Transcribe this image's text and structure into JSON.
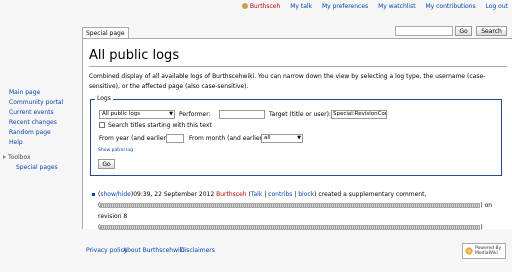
{
  "personal": {
    "username": "Burthscehwiki",
    "items": [
      "Burthsceh",
      "My talk",
      "My preferences",
      "My watchlist",
      "My contributions",
      "Log out"
    ]
  },
  "tab": {
    "label": "Special page"
  },
  "search": {
    "value": "",
    "go_label": "Go",
    "search_label": "Search"
  },
  "page": {
    "title": "All public logs",
    "intro": "Combined display of all available logs of Burthscehwiki. You can narrow down the view by selecting a log type, the username (case-sensitive), or the affected page (also case-sensitive)."
  },
  "logs_form": {
    "legend": "Logs",
    "log_type_selected": "All public logs",
    "performer_label": "Performer:",
    "performer_value": "",
    "target_label": "Target (title or user):",
    "target_value": "Special:RevisionCon",
    "search_prefix_label": "Search titles starting with this text",
    "search_prefix_checked": false,
    "year_label": "From year (and earlier):",
    "year_value": "",
    "month_label": "From month (and earlier):",
    "month_selected": "all",
    "show_patrol_label": "Show patrol log",
    "go_label": "Go"
  },
  "log_entry": {
    "show_hide": "show/hide",
    "timestamp": "09:39, 22 September 2012",
    "user": "Burthsceh",
    "talk": "Talk",
    "contribs": "contribs",
    "block": "block",
    "action": "created a supplementary comment,",
    "on": "on",
    "revision": "revision 8"
  },
  "sidebar": {
    "nav": [
      "Main page",
      "Community portal",
      "Current events",
      "Recent changes",
      "Random page",
      "Help"
    ],
    "toolbox_label": "Toolbox",
    "toolbox_items": [
      "Special pages"
    ]
  },
  "footer": {
    "links": [
      "Privacy policy",
      "About Burthscehwiki",
      "Disclaimers"
    ],
    "badge_line1": "Powered By",
    "badge_line2": "MediaWiki"
  },
  "colors": {
    "link": "#0645ad",
    "redlink": "#ba0000",
    "fieldset_border": "#2a4b8d"
  }
}
